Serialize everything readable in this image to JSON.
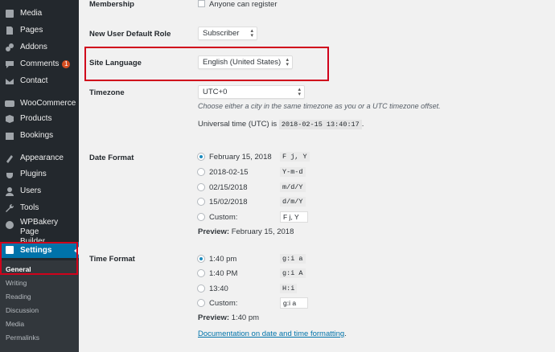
{
  "sidebar": {
    "items": [
      {
        "label": "Media",
        "icon": "media-icon"
      },
      {
        "label": "Pages",
        "icon": "pages-icon"
      },
      {
        "label": "Addons",
        "icon": "addons-icon"
      },
      {
        "label": "Comments",
        "icon": "comments-icon",
        "badge": "1"
      },
      {
        "label": "Contact",
        "icon": "contact-icon"
      },
      {
        "label": "WooCommerce",
        "icon": "woocommerce-icon"
      },
      {
        "label": "Products",
        "icon": "products-icon"
      },
      {
        "label": "Bookings",
        "icon": "bookings-icon"
      },
      {
        "label": "Appearance",
        "icon": "appearance-icon"
      },
      {
        "label": "Plugins",
        "icon": "plugins-icon"
      },
      {
        "label": "Users",
        "icon": "users-icon"
      },
      {
        "label": "Tools",
        "icon": "tools-icon"
      },
      {
        "label": "WPBakery Page Builder",
        "label_line1": "WPBakery Page",
        "label_line2": "Builder",
        "icon": "wpbakery-icon"
      },
      {
        "label": "Settings",
        "icon": "settings-icon"
      }
    ],
    "submenu": [
      "General",
      "Writing",
      "Reading",
      "Discussion",
      "Media",
      "Permalinks"
    ]
  },
  "settings": {
    "membership": {
      "label": "Membership",
      "checkbox_label": "Anyone can register"
    },
    "default_role": {
      "label": "New User Default Role",
      "value": "Subscriber"
    },
    "site_language": {
      "label": "Site Language",
      "value": "English (United States)"
    },
    "timezone": {
      "label": "Timezone",
      "value": "UTC+0",
      "description": "Choose either a city in the same timezone as you or a UTC timezone offset.",
      "utc_prefix": "Universal time (UTC) is",
      "utc_value": "2018-02-15 13:40:17",
      "utc_suffix": "."
    },
    "date_format": {
      "label": "Date Format",
      "options": [
        {
          "label": "February 15, 2018",
          "format": "F j, Y",
          "checked": true
        },
        {
          "label": "2018-02-15",
          "format": "Y-m-d"
        },
        {
          "label": "02/15/2018",
          "format": "m/d/Y"
        },
        {
          "label": "15/02/2018",
          "format": "d/m/Y"
        },
        {
          "label": "Custom:",
          "format": "F j, Y"
        }
      ],
      "preview_label": "Preview:",
      "preview_value": "February 15, 2018"
    },
    "time_format": {
      "label": "Time Format",
      "options": [
        {
          "label": "1:40 pm",
          "format": "g:i a",
          "checked": true
        },
        {
          "label": "1:40 PM",
          "format": "g:i A"
        },
        {
          "label": "13:40",
          "format": "H:i"
        },
        {
          "label": "Custom:",
          "format": "g:i a"
        }
      ],
      "preview_label": "Preview:",
      "preview_value": "1:40 pm",
      "doc_link": "Documentation on date and time formatting",
      "doc_link_suffix": "."
    }
  },
  "colors": {
    "accent": "#0073aa",
    "highlight_box": "#d0021b",
    "sidebar_bg": "#23282d",
    "badge": "#d54e21"
  }
}
